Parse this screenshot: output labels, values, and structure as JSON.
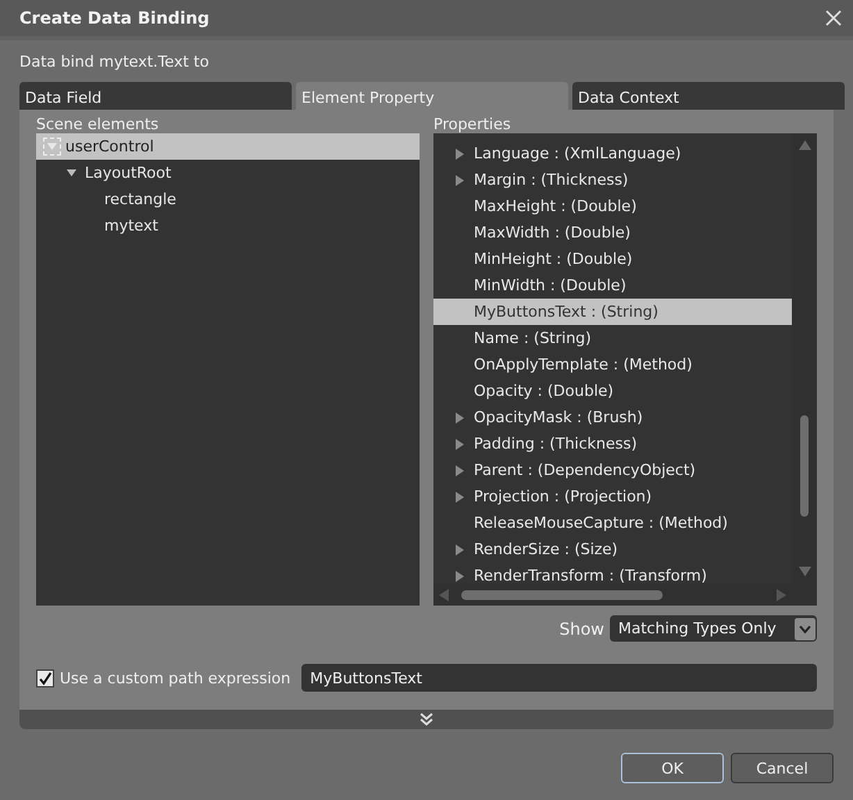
{
  "window": {
    "title": "Create Data Binding"
  },
  "prompt": "Data bind mytext.Text to",
  "tabs": [
    {
      "label": "Data Field",
      "selected": false
    },
    {
      "label": "Element Property",
      "selected": true
    },
    {
      "label": "Data Context",
      "selected": false
    }
  ],
  "scene_elements": {
    "label": "Scene elements",
    "items": [
      {
        "label": "userControl",
        "selected": true,
        "expanded": true,
        "children": [
          {
            "label": "LayoutRoot",
            "selected": false,
            "expanded": true,
            "children": [
              {
                "label": "rectangle",
                "selected": false
              },
              {
                "label": "mytext",
                "selected": false
              }
            ]
          }
        ]
      }
    ]
  },
  "properties": {
    "label": "Properties",
    "items": [
      {
        "label": "Language : (XmlLanguage)",
        "expandable": true,
        "selected": false
      },
      {
        "label": "Margin : (Thickness)",
        "expandable": true,
        "selected": false
      },
      {
        "label": "MaxHeight : (Double)",
        "expandable": false,
        "selected": false
      },
      {
        "label": "MaxWidth : (Double)",
        "expandable": false,
        "selected": false
      },
      {
        "label": "MinHeight : (Double)",
        "expandable": false,
        "selected": false
      },
      {
        "label": "MinWidth : (Double)",
        "expandable": false,
        "selected": false
      },
      {
        "label": "MyButtonsText : (String)",
        "expandable": false,
        "selected": true
      },
      {
        "label": "Name : (String)",
        "expandable": false,
        "selected": false
      },
      {
        "label": "OnApplyTemplate : (Method)",
        "expandable": false,
        "selected": false
      },
      {
        "label": "Opacity : (Double)",
        "expandable": false,
        "selected": false
      },
      {
        "label": "OpacityMask : (Brush)",
        "expandable": true,
        "selected": false
      },
      {
        "label": "Padding : (Thickness)",
        "expandable": true,
        "selected": false
      },
      {
        "label": "Parent : (DependencyObject)",
        "expandable": true,
        "selected": false
      },
      {
        "label": "Projection : (Projection)",
        "expandable": true,
        "selected": false
      },
      {
        "label": "ReleaseMouseCapture : (Method)",
        "expandable": false,
        "selected": false
      },
      {
        "label": "RenderSize : (Size)",
        "expandable": true,
        "selected": false
      },
      {
        "label": "RenderTransform : (Transform)",
        "expandable": true,
        "selected": false
      }
    ]
  },
  "show": {
    "label": "Show",
    "value": "Matching Types Only"
  },
  "custom_path": {
    "label": "Use a custom path expression",
    "checked": true,
    "value": "MyButtonsText"
  },
  "buttons": [
    {
      "label": "OK",
      "default": true
    },
    {
      "label": "Cancel",
      "default": false
    }
  ]
}
